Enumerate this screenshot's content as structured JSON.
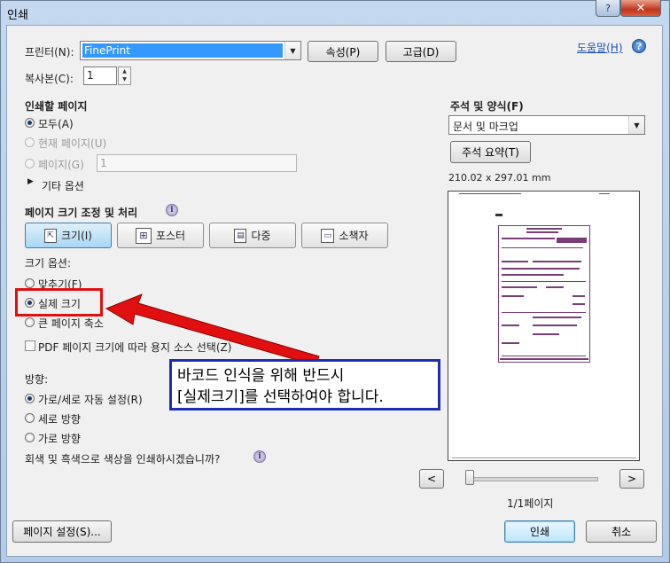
{
  "window": {
    "title": "인쇄",
    "help_cap": "?",
    "close_cap": "✕"
  },
  "printer": {
    "label": "프린터(N):",
    "value": "FinePrint",
    "properties_button": "속성(P)",
    "advanced_button": "고급(D)",
    "help_link": "도움말(H)"
  },
  "copies": {
    "label": "복사본(C):",
    "value": "1"
  },
  "pages": {
    "heading": "인쇄할 페이지",
    "all": "모두(A)",
    "current": "현재 페이지(U)",
    "range": "페이지(G)",
    "range_value": "1",
    "more_options": "기타 옵션"
  },
  "sizing": {
    "heading": "페이지 크기 조정 및 처리",
    "buttons": {
      "size": "크기(I)",
      "poster": "포스터",
      "multiple": "다중",
      "booklet": "소책자"
    },
    "options_label": "크기 옵션:",
    "fit": "맞추기(F)",
    "actual": "실제 크기",
    "shrink": "큰 페이지 축소",
    "pdf_source": "PDF 페이지 크기에 따라 용지 소스 선택(Z)"
  },
  "orientation": {
    "label": "방향:",
    "auto": "가로/세로 자동 설정(R)",
    "portrait": "세로 방향",
    "landscape": "가로 방향"
  },
  "grayscale": "회색 및 흑색으로 색상을 인쇄하시겠습니까?",
  "comments": {
    "heading": "주석 및 양식(F)",
    "value": "문서 및 마크업",
    "summary_button": "주석 요약(T)"
  },
  "preview": {
    "dimensions": "210.02 x 297.01 mm",
    "prev": "<",
    "next": ">",
    "page_count": "1/1페이지"
  },
  "footer": {
    "page_setup": "페이지 설정(S)...",
    "print": "인쇄",
    "cancel": "취소"
  },
  "annotation": {
    "callout_line1": "바코드 인식을 위해 반드시",
    "callout_line2": "[실제크기]를 선택하여야 합니다."
  },
  "colors": {
    "annotation_red": "#e01010",
    "annotation_blue": "#1f2db0",
    "preview_purple": "#7a3d78",
    "selection_blue": "#3399ff"
  }
}
